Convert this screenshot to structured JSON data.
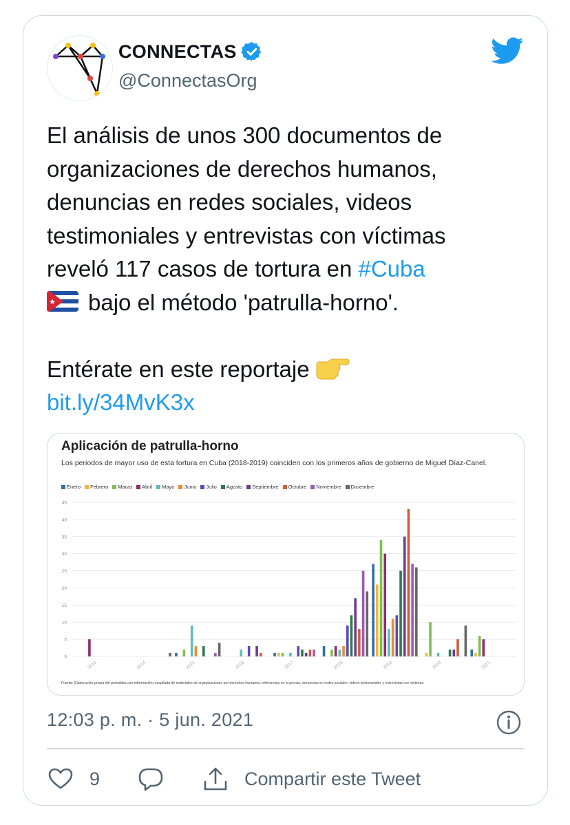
{
  "account": {
    "name": "CONNECTAS",
    "handle": "@ConnectasOrg",
    "verified": true
  },
  "tweet": {
    "line1": "El análisis de unos 300 documentos de",
    "line2": "organizaciones de derechos humanos,",
    "line3": "denuncias en redes sociales, videos",
    "line4": "testimoniales y entrevistas con víctimas",
    "line5_prefix": "reveló 117 casos de tortura en ",
    "hashtag": "#Cuba",
    "line6": "bajo el método 'patrulla-horno'.",
    "cta": "Entérate en este reportaje",
    "link": "bit.ly/34MvK3x",
    "emoji_flag": "cuba-flag-icon",
    "emoji_pointing": "pointing-right-icon"
  },
  "media": {
    "chart_title": "Aplicación de patrulla-horno",
    "chart_subtitle": "Los periodos de mayor uso de esta tortura en Cuba (2018-2019) coinciden con los primeros años de gobierno de Miguel Díaz-Canel.",
    "chart_source": "Fuente: Elaboración propia del periodista con información recopilada de materiales de organizaciones pro derechos humanos, referencias en la prensa, denuncias en redes sociales, videos testimoniales y entrevistas con víctimas."
  },
  "chart_data": {
    "type": "bar",
    "title": "Aplicación de patrulla-horno",
    "xlabel": "",
    "ylabel": "",
    "ylim": [
      0,
      45
    ],
    "yticks": [
      0,
      5,
      10,
      15,
      20,
      25,
      30,
      35,
      40,
      45
    ],
    "categories": [
      "2013",
      "2014",
      "2015",
      "2016",
      "2017",
      "2018",
      "2019",
      "2020",
      "2021"
    ],
    "legend_position": "top",
    "grid": true,
    "series": [
      {
        "name": "Enero",
        "color": "#2f6fa8",
        "values": [
          0,
          0,
          1,
          0,
          1,
          3,
          27,
          0,
          2
        ]
      },
      {
        "name": "Febrero",
        "color": "#f0b73d",
        "values": [
          0,
          0,
          0,
          0,
          1,
          0,
          21,
          1,
          1
        ]
      },
      {
        "name": "Marzo",
        "color": "#7fbf4f",
        "values": [
          0,
          0,
          2,
          0,
          1,
          2,
          34,
          10,
          6
        ]
      },
      {
        "name": "Abril",
        "color": "#8e2d6e",
        "values": [
          5,
          0,
          0,
          0,
          0,
          3,
          30,
          0,
          5
        ]
      },
      {
        "name": "Mayo",
        "color": "#5bbdbb",
        "values": [
          0,
          0,
          9,
          2,
          1,
          2,
          8,
          1,
          0
        ]
      },
      {
        "name": "Junio",
        "color": "#f08a35",
        "values": [
          0,
          0,
          3,
          0,
          0,
          3,
          11,
          0,
          0
        ]
      },
      {
        "name": "Julio",
        "color": "#5b4ab3",
        "values": [
          0,
          0,
          0,
          3,
          3,
          9,
          12,
          0,
          0
        ]
      },
      {
        "name": "Agosto",
        "color": "#2d7a4a",
        "values": [
          0,
          0,
          3,
          0,
          2,
          12,
          25,
          2,
          0
        ]
      },
      {
        "name": "Septiembre",
        "color": "#6b3d8a",
        "values": [
          0,
          0,
          0,
          3,
          1,
          17,
          35,
          2,
          0
        ]
      },
      {
        "name": "Octubre",
        "color": "#d35b3d",
        "values": [
          0,
          0,
          0,
          1,
          2,
          8,
          43,
          5,
          0
        ]
      },
      {
        "name": "Noviembre",
        "color": "#9b59b6",
        "values": [
          0,
          0,
          1,
          0,
          2,
          25,
          27,
          0,
          0
        ]
      },
      {
        "name": "Diciembre",
        "color": "#666666",
        "values": [
          0,
          1,
          4,
          0,
          0,
          19,
          26,
          9,
          0
        ]
      }
    ]
  },
  "footer": {
    "timestamp": "12:03 p. m. · 5 jun. 2021",
    "like_count": "9",
    "share_label": "Compartir este Tweet"
  },
  "colors": {
    "accent": "#1d9bf0",
    "muted": "#536471",
    "border": "#cfd9de"
  }
}
